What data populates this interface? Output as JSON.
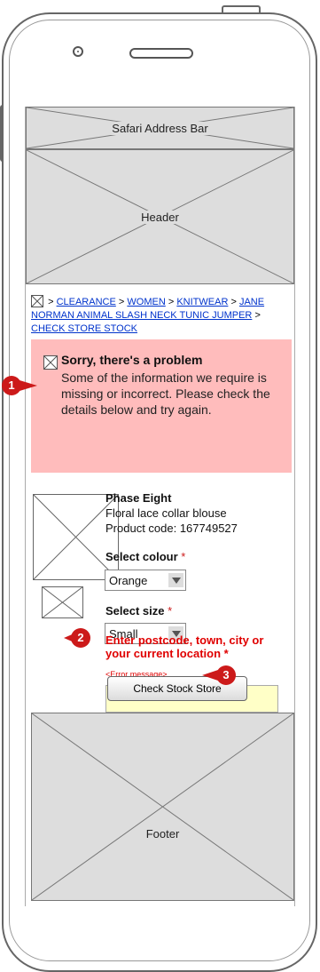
{
  "placeholders": {
    "address_bar": "Safari Address Bar",
    "header": "Header",
    "footer": "Footer"
  },
  "breadcrumb": {
    "sep": ">",
    "items": [
      "CLEARANCE",
      "WOMEN",
      "KNITWEAR",
      "JANE NORMAN ANIMAL SLASH NECK TUNIC JUMPER",
      "CHECK STORE STOCK"
    ]
  },
  "error": {
    "title": "Sorry, there's a problem",
    "body": "Some of the information we require is missing or incorrect. Please check the details below and try again."
  },
  "product": {
    "brand": "Phase Eight",
    "name": "Floral lace collar blouse",
    "code": "Product code: 167749527"
  },
  "colour": {
    "label": "Select colour",
    "required": "*",
    "value": "Orange"
  },
  "size": {
    "label": "Select size",
    "required": "*",
    "value": "Small"
  },
  "location": {
    "label": "Enter postcode, town, city or your current location",
    "required": "*",
    "error_message": "<Error message>",
    "value": ""
  },
  "check_button": "Check Stock Store",
  "annotations": [
    "1",
    "2",
    "3"
  ],
  "colors": {
    "error_bg": "#ffbcbc",
    "error_red": "#e00000",
    "badge": "#cc1a1a",
    "input_bg": "#ffffc7"
  }
}
